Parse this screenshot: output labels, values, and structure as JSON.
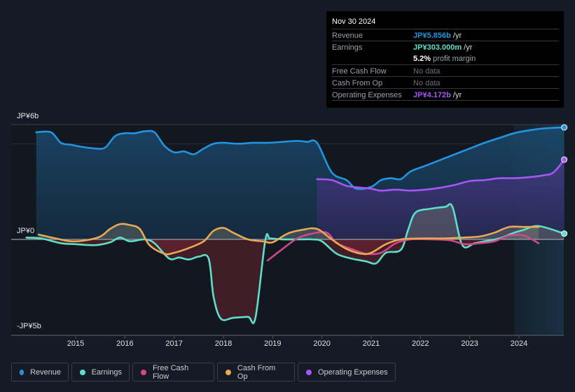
{
  "tooltip": {
    "date": "Nov 30 2024",
    "rows": [
      {
        "label": "Revenue",
        "value": "JP¥5.856b",
        "suffix": " /yr",
        "color": "#2394df"
      },
      {
        "label": "Earnings",
        "value": "JP¥303.000m",
        "suffix": " /yr",
        "color": "#5de0c9"
      },
      {
        "label": "",
        "value": "5.2%",
        "suffix": " profit margin",
        "color": "#ffffff"
      },
      {
        "label": "Free Cash Flow",
        "value": "No data",
        "suffix": "",
        "color": "#6b7078"
      },
      {
        "label": "Cash From Op",
        "value": "No data",
        "suffix": "",
        "color": "#6b7078"
      },
      {
        "label": "Operating Expenses",
        "value": "JP¥4.172b",
        "suffix": " /yr",
        "color": "#a855f7"
      }
    ]
  },
  "legend": [
    {
      "label": "Revenue",
      "color": "#2394df"
    },
    {
      "label": "Earnings",
      "color": "#5de0c9"
    },
    {
      "label": "Free Cash Flow",
      "color": "#d2478c"
    },
    {
      "label": "Cash From Op",
      "color": "#e9a955"
    },
    {
      "label": "Operating Expenses",
      "color": "#a855f7"
    }
  ],
  "chart_data": {
    "type": "line",
    "title": "",
    "xlabel": "",
    "ylabel": "",
    "y_unit": "JP¥ billions",
    "ylim": [
      -5,
      6
    ],
    "ytick_labels": [
      "JP¥6b",
      "JP¥0",
      "-JP¥5b"
    ],
    "xtick_labels": [
      "2015",
      "2016",
      "2017",
      "2018",
      "2019",
      "2020",
      "2021",
      "2022",
      "2023",
      "2024"
    ],
    "xlim": [
      2014.0,
      2024.92
    ],
    "forecast_shade_start": 2023.9,
    "series": [
      {
        "name": "Revenue",
        "color": "#2394df",
        "x": [
          2014.2,
          2014.5,
          2014.7,
          2014.9,
          2015.1,
          2015.4,
          2015.6,
          2015.8,
          2016.0,
          2016.2,
          2016.4,
          2016.6,
          2016.8,
          2017.0,
          2017.2,
          2017.4,
          2017.6,
          2017.8,
          2018.0,
          2018.3,
          2018.6,
          2018.9,
          2019.2,
          2019.5,
          2019.7,
          2019.9,
          2020.2,
          2020.5,
          2020.7,
          2021.0,
          2021.2,
          2021.4,
          2021.6,
          2021.8,
          2022.1,
          2022.4,
          2022.7,
          2023.0,
          2023.3,
          2023.6,
          2023.9,
          2024.2,
          2024.5,
          2024.92
        ],
        "y": [
          5.6,
          5.6,
          5.05,
          4.95,
          4.85,
          4.75,
          4.8,
          5.4,
          5.55,
          5.55,
          5.65,
          5.6,
          4.9,
          4.55,
          4.6,
          4.45,
          4.75,
          5.0,
          5.05,
          5.0,
          5.05,
          5.05,
          5.1,
          5.15,
          5.1,
          5.05,
          3.5,
          3.1,
          2.65,
          2.75,
          3.1,
          3.2,
          3.15,
          3.55,
          3.85,
          4.15,
          4.45,
          4.75,
          5.05,
          5.3,
          5.55,
          5.7,
          5.8,
          5.856
        ]
      },
      {
        "name": "Earnings",
        "color": "#5de0c9",
        "x": [
          2014.0,
          2014.3,
          2014.7,
          2015.0,
          2015.4,
          2015.7,
          2015.9,
          2016.1,
          2016.4,
          2016.6,
          2016.9,
          2017.1,
          2017.3,
          2017.5,
          2017.7,
          2017.8,
          2017.95,
          2018.2,
          2018.5,
          2018.65,
          2018.85,
          2018.95,
          2019.2,
          2019.5,
          2019.8,
          2020.0,
          2020.3,
          2020.6,
          2020.9,
          2021.1,
          2021.3,
          2021.6,
          2021.75,
          2021.9,
          2022.2,
          2022.5,
          2022.65,
          2022.85,
          2023.1,
          2023.3,
          2023.6,
          2023.9,
          2024.1,
          2024.4,
          2024.92
        ],
        "y": [
          0.1,
          0.05,
          -0.2,
          -0.25,
          -0.3,
          -0.15,
          0.1,
          -0.1,
          0.0,
          -0.2,
          -1.0,
          -0.95,
          -1.05,
          -0.9,
          -1.0,
          -3.0,
          -4.15,
          -4.1,
          -4.05,
          -4.1,
          -0.05,
          0.05,
          0.0,
          0.0,
          0.0,
          -0.1,
          -0.75,
          -1.0,
          -1.15,
          -1.25,
          -0.7,
          -0.55,
          0.5,
          1.4,
          1.6,
          1.7,
          1.7,
          -0.3,
          -0.2,
          -0.1,
          0.05,
          0.35,
          0.5,
          0.7,
          0.303
        ]
      },
      {
        "name": "Free Cash Flow",
        "color": "#d2478c",
        "x": [
          2018.9,
          2019.2,
          2019.5,
          2019.8,
          2020.1,
          2020.3,
          2020.6,
          2020.9,
          2021.2,
          2021.5,
          2021.8,
          2022.2,
          2022.6,
          2022.9,
          2023.2,
          2023.5,
          2023.8,
          2024.1,
          2024.4
        ],
        "y": [
          -1.1,
          -0.5,
          0.05,
          0.3,
          0.35,
          -0.2,
          -0.5,
          -0.75,
          -0.7,
          -0.2,
          0.0,
          0.0,
          -0.05,
          -0.25,
          -0.2,
          -0.1,
          0.2,
          0.2,
          -0.2
        ]
      },
      {
        "name": "Cash From Op",
        "color": "#e9a955",
        "x": [
          2014.25,
          2014.6,
          2014.9,
          2015.2,
          2015.5,
          2015.7,
          2015.9,
          2016.1,
          2016.3,
          2016.5,
          2016.8,
          2017.0,
          2017.3,
          2017.6,
          2017.8,
          2018.0,
          2018.2,
          2018.5,
          2018.8,
          2019.0,
          2019.3,
          2019.6,
          2019.9,
          2020.2,
          2020.5,
          2020.8,
          2021.0,
          2021.3,
          2021.6,
          2022.0,
          2022.5,
          2022.9,
          2023.2,
          2023.5,
          2023.8,
          2024.1,
          2024.4
        ],
        "y": [
          0.25,
          0.05,
          -0.1,
          -0.05,
          0.15,
          0.55,
          0.8,
          0.75,
          0.55,
          -0.3,
          -0.75,
          -0.7,
          -0.45,
          -0.1,
          0.45,
          0.6,
          0.35,
          0.0,
          -0.1,
          -0.15,
          0.3,
          0.5,
          0.55,
          0.0,
          -0.5,
          -0.75,
          -0.7,
          -0.25,
          0.0,
          0.05,
          0.05,
          0.1,
          0.15,
          0.35,
          0.65,
          0.65,
          0.65
        ]
      },
      {
        "name": "Operating Expenses",
        "color": "#a855f7",
        "x": [
          2019.9,
          2020.2,
          2020.5,
          2020.8,
          2021.0,
          2021.2,
          2021.5,
          2021.8,
          2022.1,
          2022.4,
          2022.7,
          2023.0,
          2023.3,
          2023.6,
          2023.9,
          2024.2,
          2024.5,
          2024.7,
          2024.92
        ],
        "y": [
          3.15,
          3.1,
          2.8,
          2.7,
          2.65,
          2.55,
          2.6,
          2.55,
          2.6,
          2.7,
          2.85,
          3.05,
          3.1,
          3.2,
          3.2,
          3.25,
          3.35,
          3.5,
          4.172
        ]
      }
    ]
  }
}
